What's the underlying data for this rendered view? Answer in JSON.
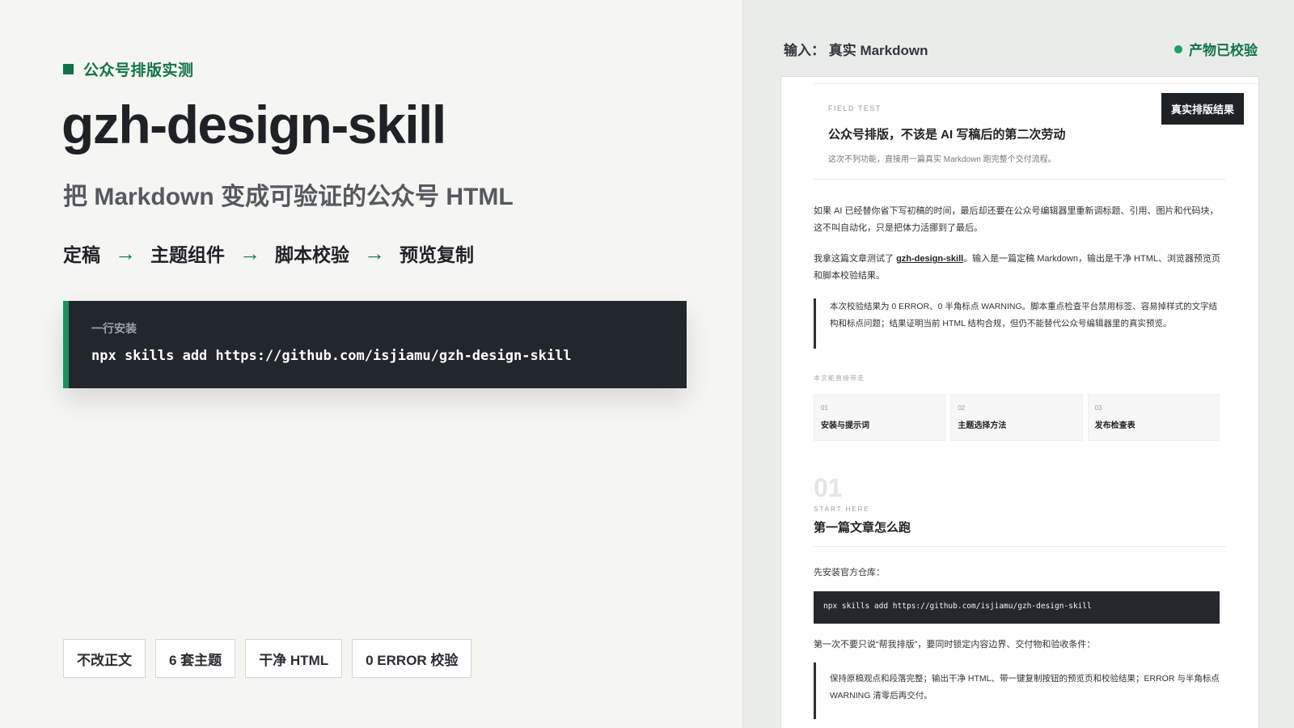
{
  "left": {
    "eyebrow": "公众号排版实测",
    "title": "gzh-design-skill",
    "subtitle": "把 Markdown 变成可验证的公众号 HTML",
    "flow": [
      "定稿",
      "主题组件",
      "脚本校验",
      "预览复制"
    ],
    "arrow": "→",
    "install": {
      "label": "一行安装",
      "command": "npx skills add https://github.com/isjiamu/gzh-design-skill"
    },
    "tags": [
      "不改正文",
      "6 套主题",
      "干净 HTML",
      "0 ERROR 校验"
    ]
  },
  "right": {
    "input_label": "输入：  真实 Markdown",
    "status": "产物已校验",
    "doc": {
      "badge": "真实排版结果",
      "kicker": "FIELD TEST",
      "title": "公众号排版，不该是 AI 写稿后的第二次劳动",
      "subtitle": "这次不列功能，直接用一篇真实 Markdown 跑完整个交付流程。",
      "para1": "如果 AI 已经替你省下写初稿的时间，最后却还要在公众号编辑器里重新调标题、引用、图片和代码块，这不叫自动化，只是把体力活挪到了最后。",
      "para2_before": "我拿这篇文章测试了 ",
      "para2_link": "gzh-design-skill",
      "para2_after": "。输入是一篇定稿 Markdown，输出是干净 HTML、浏览器预览页和脚本校验结果。",
      "quote1": "本次校验结果为 0 ERROR、0 半角标点 WARNING。脚本重点检查平台禁用标签、容易掉样式的文字结构和标点问题；结果证明当前 HTML 结构合规，但仍不能替代公众号编辑器里的真实预览。",
      "toc_title": "本文能直接带走",
      "toc": [
        {
          "num": "01",
          "label": "安装与提示词"
        },
        {
          "num": "02",
          "label": "主题选择方法"
        },
        {
          "num": "03",
          "label": "发布检查表"
        }
      ],
      "section_num": "01",
      "section_kicker": "START HERE",
      "section_title": "第一篇文章怎么跑",
      "para3": "先安装官方仓库：",
      "code": "npx skills add https://github.com/isjiamu/gzh-design-skill",
      "para4": "第一次不要只说“帮我排版”，要同时锁定内容边界、交付物和验收条件：",
      "quote2": "保持原稿观点和段落完整；输出干净 HTML、带一键复制按钮的预览页和校验结果；ERROR 与半角标点 WARNING 清零后再交付。"
    }
  },
  "colors": {
    "accent": "#10744a",
    "dark": "#22262d",
    "status_dot": "#18a15f"
  }
}
